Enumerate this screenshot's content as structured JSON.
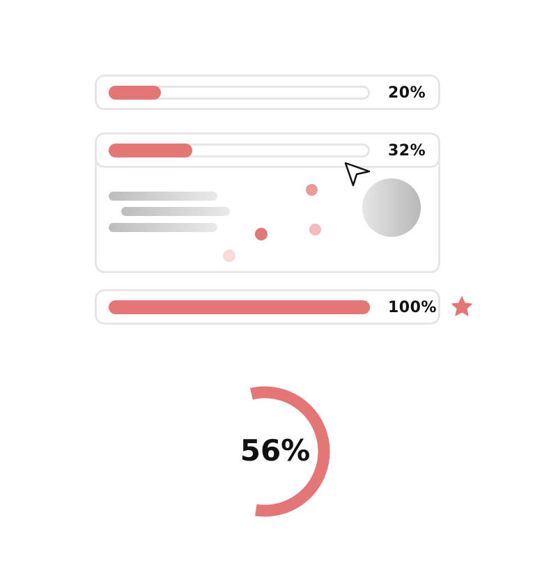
{
  "progress_bars": [
    {
      "label": "20%",
      "value": 0.2
    },
    {
      "label": "32%",
      "value": 0.32
    },
    {
      "label": "100%",
      "value": 1.0
    }
  ],
  "ring": {
    "label": "56%",
    "value": 0.56
  },
  "icons": {
    "cursor": "cursor-arrow-icon",
    "star": "star-icon"
  },
  "colors": {
    "accent": "#e57676",
    "border": "#e6e6e6",
    "text": "#111111"
  }
}
